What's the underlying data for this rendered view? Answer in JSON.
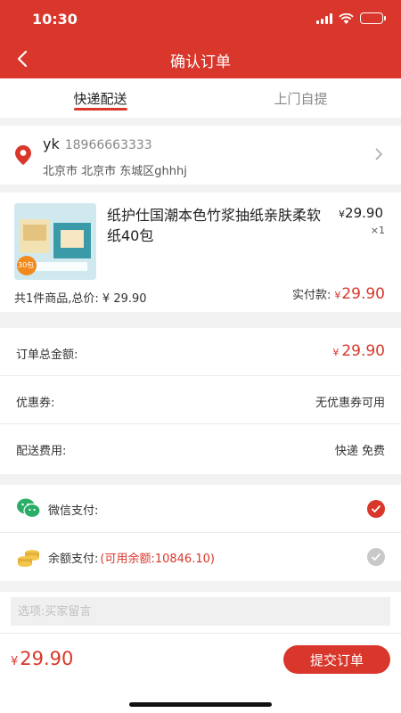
{
  "status_bar": {
    "time": "10:30"
  },
  "header": {
    "title": "确认订单"
  },
  "tabs": [
    {
      "label": "快递配送",
      "active": true
    },
    {
      "label": "上门自提",
      "active": false
    }
  ],
  "address": {
    "name": "yk",
    "phone": "18966663333",
    "detail": "北京市 北京市 东城区ghhhj"
  },
  "product": {
    "name": "纸护仕国潮本色竹浆抽纸亲肤柔软纸40包",
    "currency": "¥",
    "price": "29.90",
    "qty": "×1",
    "image_badge": "30包",
    "summary": "共1件商品,总价: ¥ 29.90",
    "paid_label": "实付款:",
    "paid_value": "29.90"
  },
  "amounts": {
    "order_total_label": "订单总金额:",
    "order_total_value": "29.90",
    "coupon_label": "优惠券:",
    "coupon_value": "无优惠券可用",
    "delivery_label": "配送费用:",
    "delivery_value": "快递 免费"
  },
  "payment": {
    "wechat_label": "微信支付:",
    "balance_label": "余额支付:",
    "balance_hint": "(可用余额:10846.10)",
    "selected": "wechat"
  },
  "note": {
    "placeholder": "选项:买家留言"
  },
  "footer": {
    "currency": "¥",
    "total": "29.90",
    "submit_label": "提交订单"
  },
  "colors": {
    "accent": "#d9372b",
    "wechat": "#2aae67"
  }
}
